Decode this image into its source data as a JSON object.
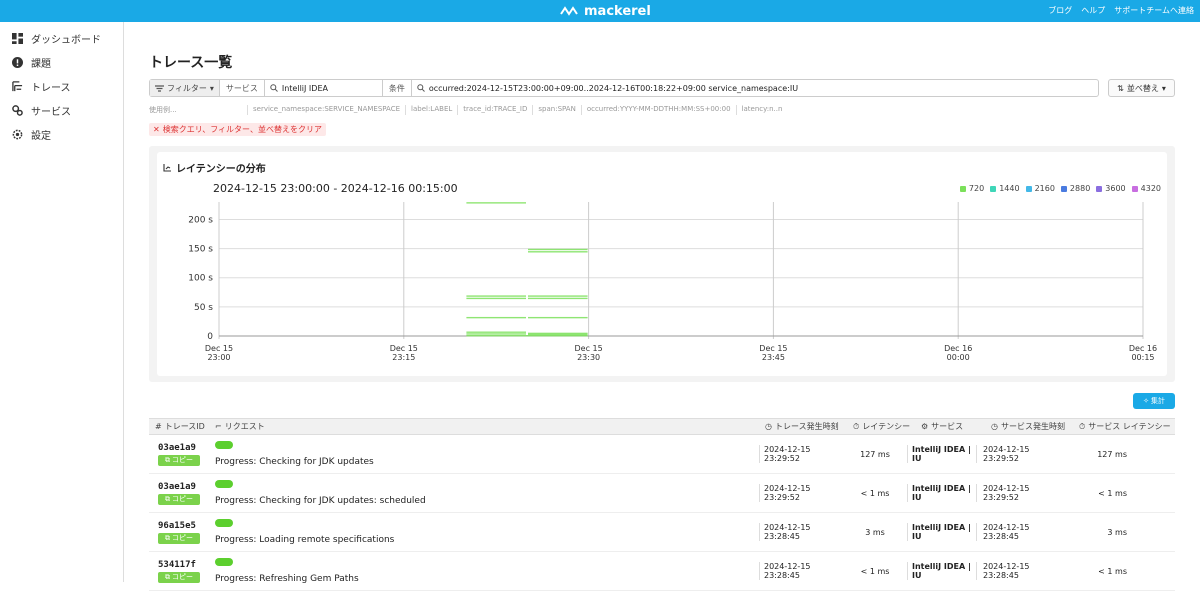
{
  "app": {
    "brand": "mackerel"
  },
  "topnav": {
    "links": [
      "ブログ",
      "ヘルプ",
      "サポートチームへ連絡"
    ]
  },
  "sidebar": {
    "items": [
      {
        "label": "ダッシュボード",
        "icon": "dashboard-icon"
      },
      {
        "label": "課題",
        "icon": "alert-icon"
      },
      {
        "label": "トレース",
        "icon": "trace-icon"
      },
      {
        "label": "サービス",
        "icon": "service-icon"
      },
      {
        "label": "設定",
        "icon": "settings-icon"
      }
    ]
  },
  "page": {
    "title": "トレース一覧"
  },
  "search": {
    "filter_label": "フィルター",
    "service_label": "サービス",
    "service_value": "IntelliJ IDEA",
    "condition_label": "条件",
    "condition_value": "occurred:2024-12-15T23:00:00+09:00..2024-12-16T00:18:22+09:00 service_namespace:IU",
    "sort_label": "並べ替え"
  },
  "examples": [
    "使用例...",
    "service_namespace:SERVICE_NAMESPACE",
    "label:LABEL",
    "trace_id:TRACE_ID",
    "span:SPAN",
    "occurred:YYYY-MM-DDTHH:MM:SS+00:00",
    "latency:n..n"
  ],
  "clear_label": "検索クエリ、フィルター、並べ替えをクリア",
  "chart_panel": {
    "title": "レイテンシーの分布",
    "range": "2024-12-15 23:00:00 - 2024-12-16 00:15:00"
  },
  "chart_data": {
    "type": "heatmap",
    "title": "レイテンシーの分布",
    "subtitle": "2024-12-15 23:00:00 - 2024-12-16 00:15:00",
    "x_ticks": [
      [
        "Dec 15",
        "23:00"
      ],
      [
        "Dec 15",
        "23:15"
      ],
      [
        "Dec 15",
        "23:30"
      ],
      [
        "Dec 15",
        "23:45"
      ],
      [
        "Dec 16",
        "00:00"
      ],
      [
        "Dec 16",
        "00:15"
      ]
    ],
    "x_tick_minutes": [
      0,
      15,
      30,
      45,
      60,
      75
    ],
    "y_ticks": [
      "0",
      "50 s",
      "100 s",
      "150 s",
      "200 s"
    ],
    "y_tick_values": [
      0,
      50,
      100,
      150,
      200
    ],
    "ylim": [
      0,
      230
    ],
    "legend": [
      {
        "label": "720",
        "color": "#7be05a"
      },
      {
        "label": "1440",
        "color": "#3fd6b8"
      },
      {
        "label": "2160",
        "color": "#43b8e8"
      },
      {
        "label": "2880",
        "color": "#4a7be0"
      },
      {
        "label": "3600",
        "color": "#8a6ee0"
      },
      {
        "label": "4320",
        "color": "#c86ee0"
      }
    ],
    "cells": [
      {
        "x0": 20,
        "x1": 25,
        "y": 228
      },
      {
        "x0": 25,
        "x1": 30,
        "y": 148
      },
      {
        "x0": 25,
        "x1": 30,
        "y": 144
      },
      {
        "x0": 20,
        "x1": 25,
        "y": 68
      },
      {
        "x0": 20,
        "x1": 25,
        "y": 64
      },
      {
        "x0": 25,
        "x1": 30,
        "y": 68
      },
      {
        "x0": 25,
        "x1": 30,
        "y": 64
      },
      {
        "x0": 20,
        "x1": 25,
        "y": 31
      },
      {
        "x0": 25,
        "x1": 30,
        "y": 31
      },
      {
        "x0": 20,
        "x1": 25,
        "y": 6
      },
      {
        "x0": 20,
        "x1": 25,
        "y": 3
      },
      {
        "x0": 25,
        "x1": 30,
        "y": 4
      },
      {
        "x0": 25,
        "x1": 30,
        "y": 2
      },
      {
        "x0": 20,
        "x1": 30,
        "y": 0
      }
    ]
  },
  "aggregate_label": "集計",
  "table": {
    "headers": [
      "トレースID",
      "リクエスト",
      "トレース発生時刻",
      "レイテンシー",
      "サービス",
      "サービス発生時刻",
      "サービス レイテンシー"
    ],
    "copy_label": "コピー",
    "rows": [
      {
        "id": "03ae1a9",
        "request": "Progress: Checking for JDK updates",
        "time": "2024-12-15 23:29:52",
        "latency": "127 ms",
        "service": "IntelliJ IDEA | IU",
        "service_time": "2024-12-15 23:29:52",
        "service_latency": "127 ms"
      },
      {
        "id": "03ae1a9",
        "request": "Progress: Checking for JDK updates: scheduled",
        "time": "2024-12-15 23:29:52",
        "latency": "< 1 ms",
        "service": "IntelliJ IDEA | IU",
        "service_time": "2024-12-15 23:29:52",
        "service_latency": "< 1 ms"
      },
      {
        "id": "96a15e5",
        "request": "Progress: Loading remote specifications",
        "time": "2024-12-15 23:28:45",
        "latency": "3 ms",
        "service": "IntelliJ IDEA | IU",
        "service_time": "2024-12-15 23:28:45",
        "service_latency": "3 ms"
      },
      {
        "id": "534117f",
        "request": "Progress: Refreshing Gem Paths",
        "time": "2024-12-15 23:28:45",
        "latency": "< 1 ms",
        "service": "IntelliJ IDEA | IU",
        "service_time": "2024-12-15 23:28:45",
        "service_latency": "< 1 ms"
      }
    ]
  }
}
